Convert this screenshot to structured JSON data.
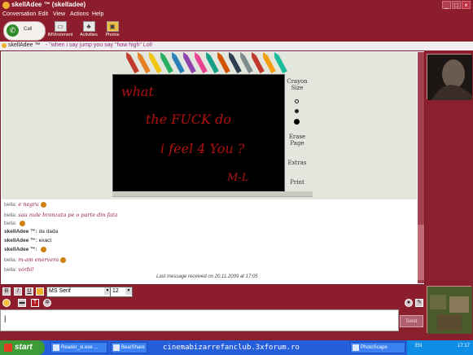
{
  "window": {
    "title": "skellAdee ™ (skelladee)",
    "controls": [
      "_",
      "□",
      "×"
    ]
  },
  "menu": [
    "Conversation",
    "Edit",
    "View",
    "Actions",
    "Help"
  ],
  "toolbar": {
    "call_label": "Call",
    "tools": [
      {
        "label": "IMVironment",
        "icon": "imvironment-icon"
      },
      {
        "label": "Activities",
        "icon": "activities-icon"
      },
      {
        "label": "Photos",
        "icon": "photos-icon"
      }
    ]
  },
  "status": {
    "name": "skellAdee ™",
    "message": "- \"when i say jump you say \"how high\" Lol!"
  },
  "imvironment": {
    "tools": [
      "Crayon Size",
      "Erase Page",
      "Extras",
      "Print"
    ],
    "crayon_colors": [
      "#c0392b",
      "#e67e22",
      "#f1c40f",
      "#27ae60",
      "#2980b9",
      "#8e44ad",
      "#e84393",
      "#16a085",
      "#d35400",
      "#2c3e50",
      "#7f8c8d",
      "#c0392b",
      "#f39c12",
      "#1abc9c"
    ],
    "drawing_lines": [
      "what",
      "the FUCK do",
      "i feel 4 You ?",
      "M-L"
    ]
  },
  "chat": {
    "messages": [
      {
        "sender": "bella:",
        "text": "e negru",
        "style": "ital",
        "emoticon": true
      },
      {
        "sender": "bella:",
        "text": "sau nule bronzata pe o parte din fata",
        "style": "ital",
        "emoticon": false
      },
      {
        "sender": "bella:",
        "text": "",
        "style": "ital",
        "emoticon": true
      },
      {
        "sender": "skellAdee ™:",
        "text": "da dada",
        "style": "plain",
        "emoticon": false
      },
      {
        "sender": "skellAdee ™:",
        "text": "exact",
        "style": "plain",
        "emoticon": false
      },
      {
        "sender": "skellAdee ™:",
        "text": "",
        "style": "plain",
        "emoticon": true
      },
      {
        "sender": "bella:",
        "text": "m-am enervera",
        "style": "ital",
        "emoticon": true
      },
      {
        "sender": "bella:",
        "text": "vorbi!",
        "style": "ital",
        "emoticon": false
      }
    ],
    "last_received": "Last message received on 20.11.2009 at 17:05"
  },
  "format": {
    "font": "MS Serif",
    "size": "12"
  },
  "input": {
    "value": "|",
    "send_label": "Send"
  },
  "taskbar": {
    "start_label": "start",
    "tasks": [
      "Reader_sl.exe ...",
      "BearShare",
      "",
      "PhotoScape"
    ],
    "watermark": "cinemabizarrefanclub.3xforum.ro",
    "lang": "EN",
    "clock": "17:17"
  },
  "colors": {
    "accent": "#8c1d2c",
    "chat_italic": "#9a2040",
    "taskbar": "#245edb"
  }
}
